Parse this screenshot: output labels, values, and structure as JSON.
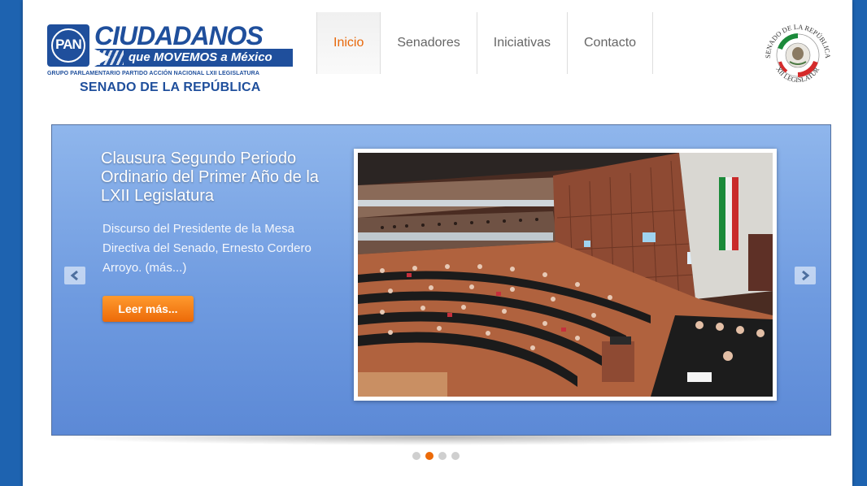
{
  "header": {
    "logo": {
      "pan_label": "PAN",
      "brand_word": "CIUDADANOS",
      "brand_tagline": "que MOVEMOS a México",
      "group_line": "GRUPO PARLAMENTARIO PARTIDO ACCIÓN NACIONAL LXII LEGISLATURA",
      "senate_line": "SENADO DE LA REPÚBLICA"
    },
    "nav": [
      {
        "label": "Inicio",
        "active": true
      },
      {
        "label": "Senadores",
        "active": false
      },
      {
        "label": "Iniciativas",
        "active": false
      },
      {
        "label": "Contacto",
        "active": false
      }
    ],
    "seal": {
      "top_text": "SENADO DE LA REPÚBLICA",
      "bottom_text": "LXII LEGISLATURA"
    }
  },
  "slider": {
    "title": "Clausura Segundo Periodo Ordinario del Primer Año de la LXII Legislatura",
    "description": "Discurso del Presidente de la Mesa Directiva del Senado, Ernesto Cordero Arroyo. (más...)",
    "button_label": "Leer más...",
    "photo_icon": "senate-chamber-photo",
    "prev_icon": "chevron-left-icon",
    "next_icon": "chevron-right-icon",
    "slide_count": 4,
    "active_slide": 2
  },
  "colors": {
    "brand_blue": "#1f4f9c",
    "accent_orange": "#ec6a08",
    "page_background": "#1e63b0"
  }
}
